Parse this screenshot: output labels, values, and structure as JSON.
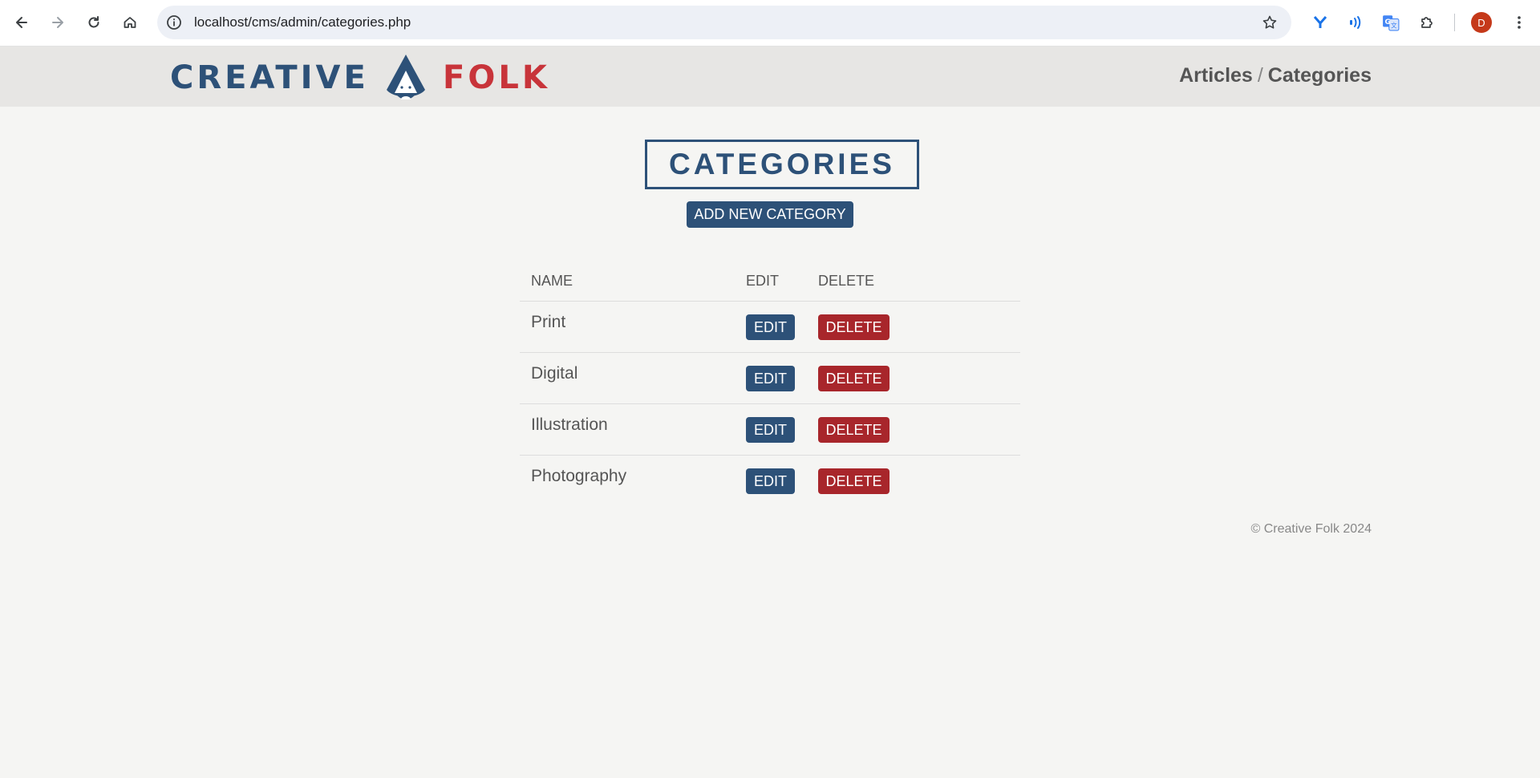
{
  "browser": {
    "url": "localhost/cms/admin/categories.php",
    "avatar_letter": "D",
    "icons": [
      "back-arrow-icon",
      "forward-arrow-icon",
      "reload-icon",
      "home-icon",
      "info-icon",
      "star-icon",
      "extension-y-icon",
      "extension-wave-icon",
      "translate-icon",
      "puzzle-icon",
      "kebab-menu-icon"
    ]
  },
  "header": {
    "logo": {
      "word1": "CREATIVE",
      "word2": "FOLK"
    },
    "nav": {
      "articles": "Articles",
      "separator": "/",
      "categories": "Categories"
    }
  },
  "main": {
    "title": "CATEGORIES",
    "add_button": "ADD NEW CATEGORY",
    "table": {
      "headers": {
        "name": "NAME",
        "edit": "EDIT",
        "delete": "DELETE"
      },
      "rows": [
        {
          "name": "Print",
          "edit": "EDIT",
          "delete": "DELETE"
        },
        {
          "name": "Digital",
          "edit": "EDIT",
          "delete": "DELETE"
        },
        {
          "name": "Illustration",
          "edit": "EDIT",
          "delete": "DELETE"
        },
        {
          "name": "Photography",
          "edit": "EDIT",
          "delete": "DELETE"
        }
      ]
    }
  },
  "footer": {
    "text": "© Creative Folk 2024"
  },
  "colors": {
    "primary": "#2d5178",
    "danger": "#a8262b",
    "accent_red": "#c8343a",
    "accent_yellow": "#e8a236",
    "background": "#f5f5f3",
    "header_bg": "#e7e6e4"
  }
}
